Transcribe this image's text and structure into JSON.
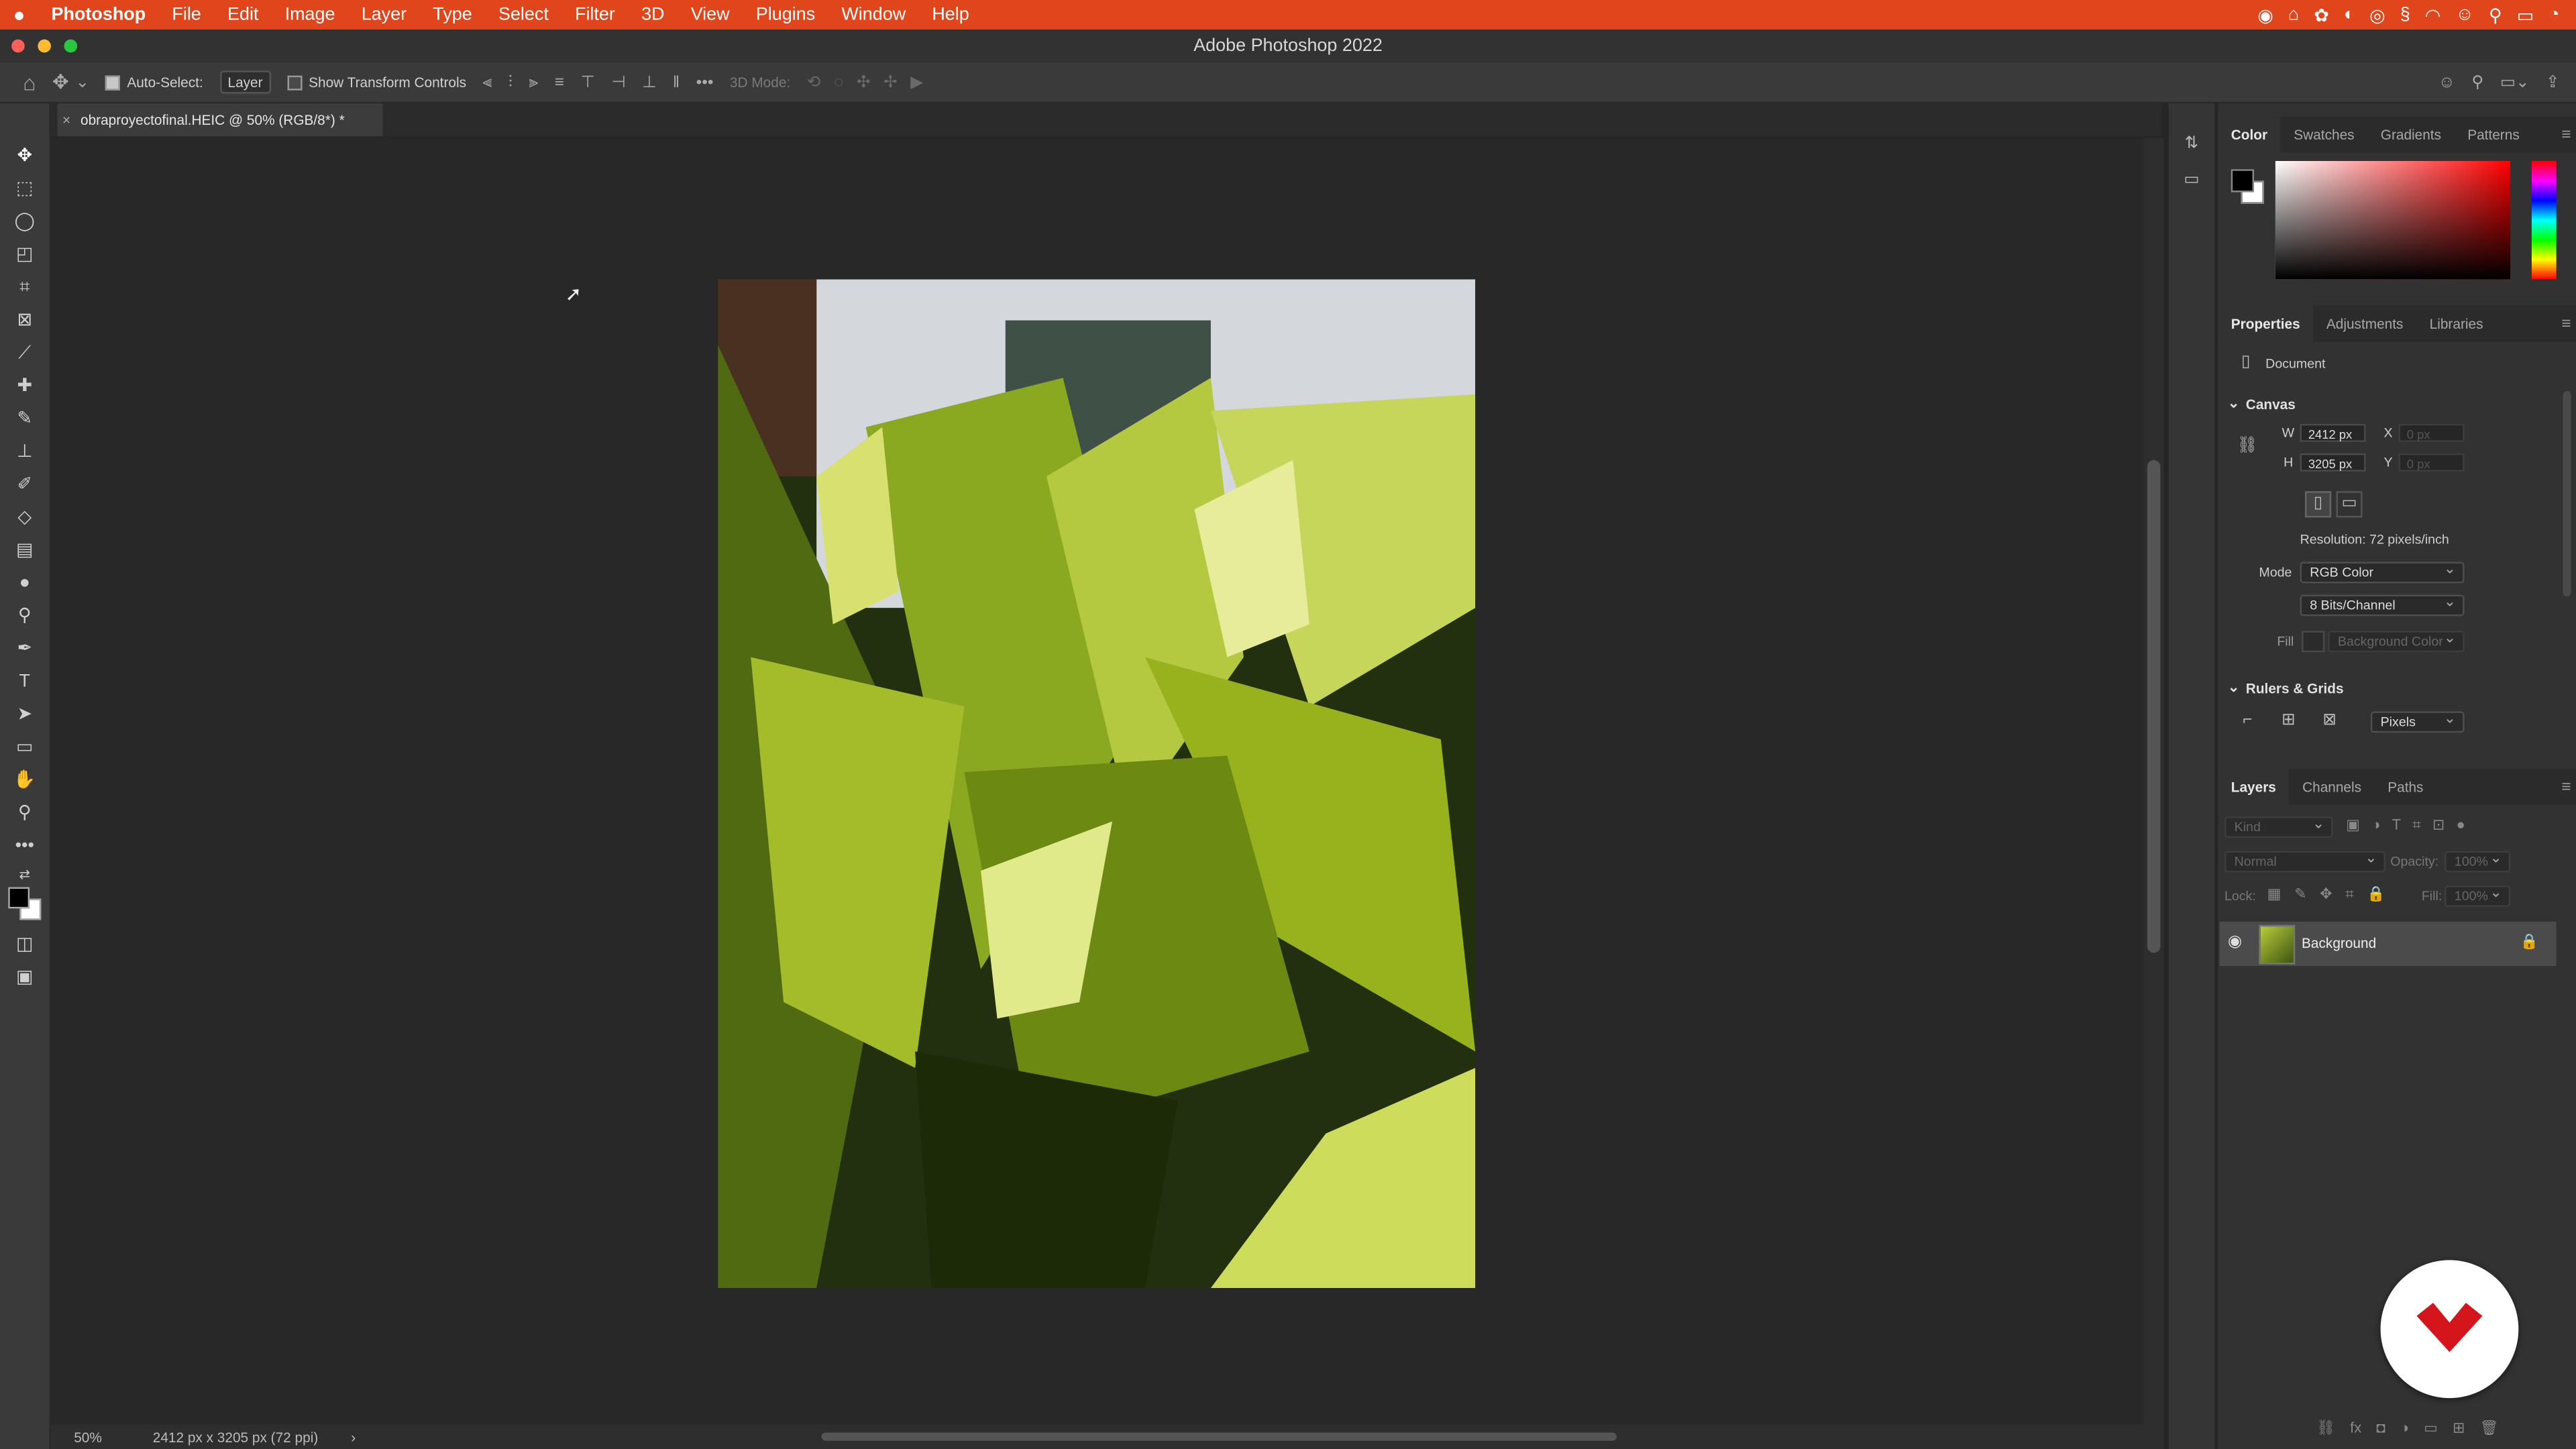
{
  "colors": {
    "menubar": "#e0451c",
    "panel_bg": "#323232",
    "canvas_bg": "#282828",
    "watermark_red": "#d4161c"
  },
  "menubar": {
    "apple_icon": "apple-icon",
    "app_name": "Photoshop",
    "items": [
      "File",
      "Edit",
      "Image",
      "Layer",
      "Type",
      "Select",
      "Filter",
      "3D",
      "View",
      "Plugins",
      "Window",
      "Help"
    ]
  },
  "window": {
    "title": "Adobe Photoshop 2022"
  },
  "options_bar": {
    "auto_select_label": "Auto-Select:",
    "auto_select_checked": true,
    "auto_select_value": "Layer",
    "show_transform_label": "Show Transform Controls",
    "show_transform_checked": false,
    "three_d_mode_label": "3D Mode:"
  },
  "document_tab": {
    "title": "obraproyectofinal.HEIC @ 50% (RGB/8*) *",
    "close_glyph": "×"
  },
  "status_bar": {
    "zoom": "50%",
    "doc_info": "2412 px x 3205 px (72 ppi)",
    "arrow": "›"
  },
  "color_panel": {
    "tabs": [
      "Color",
      "Swatches",
      "Gradients",
      "Patterns"
    ],
    "active_tab": "Color",
    "foreground": "#000000",
    "background": "#ffffff",
    "hue": "#ff0000"
  },
  "properties_panel": {
    "tabs": [
      "Properties",
      "Adjustments",
      "Libraries"
    ],
    "active_tab": "Properties",
    "document_label": "Document",
    "canvas_section": "Canvas",
    "w_label": "W",
    "w_value": "2412 px",
    "h_label": "H",
    "h_value": "3205 px",
    "x_label": "X",
    "x_placeholder": "0 px",
    "y_label": "Y",
    "y_placeholder": "0 px",
    "resolution": "Resolution: 72 pixels/inch",
    "mode_label": "Mode",
    "mode_value": "RGB Color",
    "bits_value": "8 Bits/Channel",
    "fill_label": "Fill",
    "fill_value": "Background Color",
    "rulers_section": "Rulers & Grids",
    "units_value": "Pixels"
  },
  "layers_panel": {
    "tabs": [
      "Layers",
      "Channels",
      "Paths"
    ],
    "active_tab": "Layers",
    "filter_placeholder": "Kind",
    "blend_mode": "Normal",
    "opacity_label": "Opacity:",
    "opacity_value": "100%",
    "lock_label": "Lock:",
    "fill_label": "Fill:",
    "fill_value": "100%",
    "layers": [
      {
        "name": "Background",
        "visible": true,
        "locked": true
      }
    ]
  }
}
